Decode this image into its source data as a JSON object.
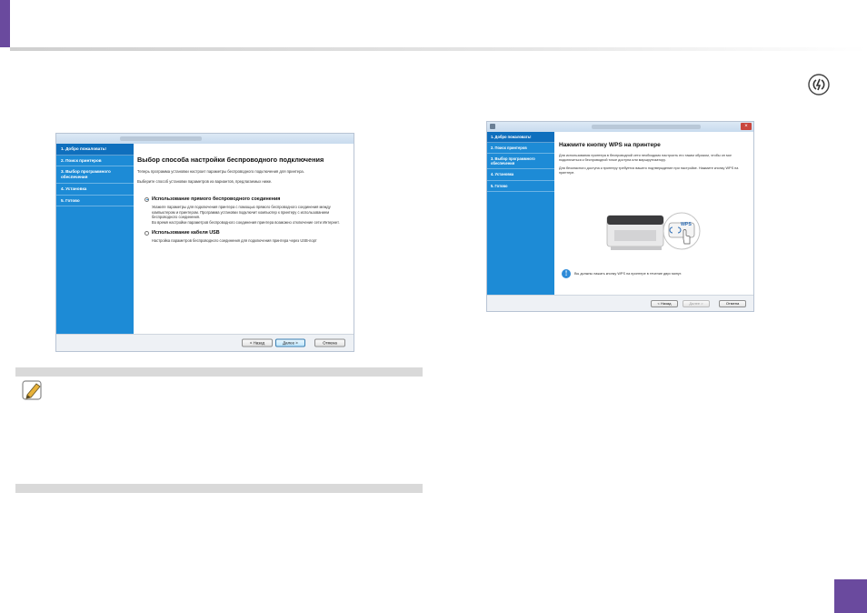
{
  "left_window": {
    "steps": [
      "1. Добро пожаловать!",
      "2. Поиск принтеров",
      "3. Выбор программного обеспечения",
      "4. Установка",
      "5. Готово"
    ],
    "title": "Выбор способа настройки беспроводного подключения",
    "intro": "Теперь программа установки настроит параметры беспроводного подключения для принтера.",
    "prompt": "Выберите способ установки параметров из вариантов, предлагаемых ниже.",
    "option1": {
      "label": "Использование прямого беспроводного соединения",
      "text": "Укажите параметры для подключения принтера с помощью прямого беспроводного соединения между компьютером и принтером. Программа установки подключит компьютер к принтеру с использованием беспроводного соединения.",
      "text2": "Во время настройки параметров беспроводного соединения принтера возможно отключение сети Интернет."
    },
    "option2": {
      "label": "Использование кабеля USB",
      "text": "Настройка параметров беспроводного соединения для подключения принтера через USB-порт"
    },
    "buttons": {
      "back": "< Назад",
      "next": "Далее >",
      "cancel": "Отмена"
    }
  },
  "right_window": {
    "close": "×",
    "steps": [
      "1. Добро пожаловать!",
      "2. Поиск принтеров",
      "3. Выбор программного обеспечения",
      "4. Установка",
      "5. Готово"
    ],
    "title": "Нажмите кнопку WPS на принтере",
    "para1": "Для использования принтера в беспроводной сети необходимо настроить его таким образом, чтобы он мог подключиться к беспроводной точке доступа или маршрутизатору.",
    "para2": "Для безопасного доступа к принтеру требуется вашего подтверждение при настройке. Нажмите кнопку WPS на принтере.",
    "wps_label": "WPS",
    "note": "Вы должны нажать кнопку WPS на принтере в течение двух минут.",
    "buttons": {
      "back": "< Назад",
      "next": "Далее >",
      "cancel": "Отмена"
    }
  },
  "colors": {
    "accent": "#6a4a9e",
    "sidebar": "#1d8bd6"
  }
}
